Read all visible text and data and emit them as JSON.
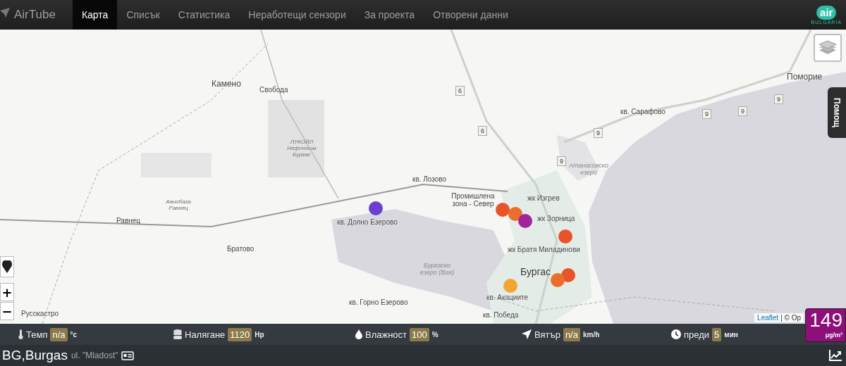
{
  "nav": {
    "brand": "AirTube",
    "tabs": [
      {
        "label": "Карта",
        "selected": true
      },
      {
        "label": "Списък",
        "selected": false
      },
      {
        "label": "Статистика",
        "selected": false
      },
      {
        "label": "Неработещи сензори",
        "selected": false
      },
      {
        "label": "За проекта",
        "selected": false
      },
      {
        "label": "Отворени данни",
        "selected": false
      }
    ],
    "logo": {
      "word": "air",
      "sub": "BULGARIA"
    }
  },
  "map": {
    "labels": [
      {
        "text": "Камено",
        "kind": "town"
      },
      {
        "text": "Свобода",
        "kind": "small"
      },
      {
        "text": "ЛУКОЙЛ Нефтохим Бургас",
        "kind": "area"
      },
      {
        "text": "Авиобаза Равнец",
        "kind": "area"
      },
      {
        "text": "Равнец",
        "kind": "small"
      },
      {
        "text": "Братово",
        "kind": "small"
      },
      {
        "text": "кв. Долно Езерово",
        "kind": "small"
      },
      {
        "text": "кв. Лозово",
        "kind": "small"
      },
      {
        "text": "Промишлена зона - Север",
        "kind": "small"
      },
      {
        "text": "жк Изгрев",
        "kind": "small"
      },
      {
        "text": "жк Зорница",
        "kind": "small"
      },
      {
        "text": "жк Братя Миладинови",
        "kind": "small"
      },
      {
        "text": "Бургас",
        "kind": "city"
      },
      {
        "text": "кв. Акациите",
        "kind": "small"
      },
      {
        "text": "кв. Горно Езерово",
        "kind": "small"
      },
      {
        "text": "Бургаско езеро (Вая)",
        "kind": "water"
      },
      {
        "text": "кв. Победа",
        "kind": "small"
      },
      {
        "text": "Атанасовско езеро",
        "kind": "water"
      },
      {
        "text": "кв. Сарафово",
        "kind": "small"
      },
      {
        "text": "Поморие",
        "kind": "town"
      },
      {
        "text": "Русокастро",
        "kind": "small"
      }
    ],
    "roads": [
      "6",
      "6",
      "9",
      "9",
      "9",
      "9",
      "9"
    ],
    "sensors": [
      {
        "color": "#6a3fd0"
      },
      {
        "color": "#e8542a"
      },
      {
        "color": "#ec6e2c"
      },
      {
        "color": "#a0249a"
      },
      {
        "color": "#e8542a"
      },
      {
        "color": "#e8542a"
      },
      {
        "color": "#ec6e2c"
      },
      {
        "color": "#f2a531"
      }
    ],
    "help": "Помощ",
    "zoom_in": "+",
    "zoom_out": "−",
    "attribution": {
      "link": "Leaflet",
      "rest": "| © Op"
    }
  },
  "stats": [
    {
      "kind": "temp",
      "label": "Темп",
      "value": "n/a",
      "unit": "°c"
    },
    {
      "kind": "pressure",
      "label": "Налягане",
      "value": "1120",
      "unit": "Hp"
    },
    {
      "kind": "humidity",
      "label": "Влажност",
      "value": "100",
      "unit": "%"
    },
    {
      "kind": "wind",
      "label": "Вятър",
      "value": "n/a",
      "unit": "km/h"
    },
    {
      "kind": "time",
      "label": "преди",
      "value": "5",
      "unit": "мин"
    }
  ],
  "reading": {
    "value": "149",
    "unit": "µg/m³",
    "color": "#8e0f7a"
  },
  "footer": {
    "city": "BG,Burgas",
    "street": "ul. \"Mladost\""
  }
}
